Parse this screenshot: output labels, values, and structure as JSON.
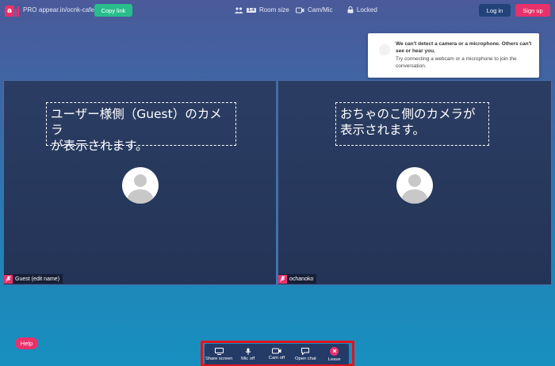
{
  "header": {
    "logo_letter": "a",
    "plan": "PRO",
    "room_url": "appear.in/ocnk-cafe",
    "copy_link": "Copy link",
    "room_size_badge": "1:4",
    "room_size": "Room size",
    "cam_mic": "Cam/Mic",
    "locked": "Locked",
    "login": "Log in",
    "signup": "Sign up"
  },
  "notice": {
    "title": "We can't detect a camera or a microphone. Others can't see or hear you.",
    "body": "Try connecting a webcam or a microphone to join the conversation."
  },
  "tiles": [
    {
      "caption": "ユーザー様側（Guest）のカメラ\nが表示されます。",
      "name": "Guest (edit name)"
    },
    {
      "caption": "おちゃのこ側のカメラが\n表示されます。",
      "name": "ochanoko"
    }
  ],
  "help": "Help",
  "controls": {
    "share_screen": "Share screen",
    "mic_off": "Mic off",
    "cam_off": "Cam off",
    "open_chat": "Open chat",
    "leave": "Leave"
  },
  "colors": {
    "accent_pink": "#e8316b",
    "copy_green": "#28bd8b",
    "login_navy": "#22437a",
    "highlight_red": "#e0141e"
  }
}
